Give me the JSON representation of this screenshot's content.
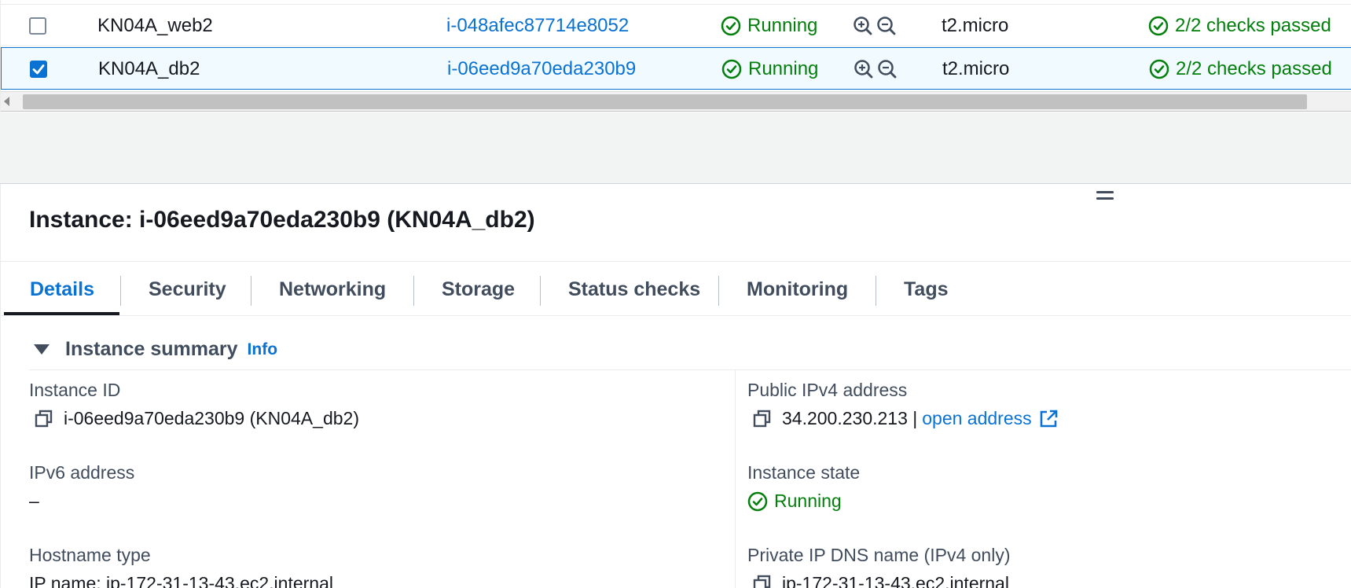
{
  "table": {
    "rows": [
      {
        "selected": false,
        "name": "KN04A_web2",
        "instance_id": "i-048afec87714e8052",
        "state": "Running",
        "instance_type": "t2.micro",
        "status_check": "2/2 checks passed"
      },
      {
        "selected": true,
        "name": "KN04A_db2",
        "instance_id": "i-06eed9a70eda230b9",
        "state": "Running",
        "instance_type": "t2.micro",
        "status_check": "2/2 checks passed"
      }
    ]
  },
  "details": {
    "title": "Instance: i-06eed9a70eda230b9 (KN04A_db2)",
    "tabs": [
      {
        "label": "Details",
        "active": true
      },
      {
        "label": "Security",
        "active": false
      },
      {
        "label": "Networking",
        "active": false
      },
      {
        "label": "Storage",
        "active": false
      },
      {
        "label": "Status checks",
        "active": false
      },
      {
        "label": "Monitoring",
        "active": false
      },
      {
        "label": "Tags",
        "active": false
      }
    ],
    "summary": {
      "title": "Instance summary",
      "info_label": "Info",
      "instance_id_label": "Instance ID",
      "instance_id_value": "i-06eed9a70eda230b9 (KN04A_db2)",
      "public_ipv4_label": "Public IPv4 address",
      "public_ipv4_value": "34.200.230.213 |",
      "open_address_label": "open address",
      "ipv6_label": "IPv6 address",
      "ipv6_value": "–",
      "instance_state_label": "Instance state",
      "instance_state_value": "Running",
      "hostname_type_label": "Hostname type",
      "hostname_type_value": "IP name: ip-172-31-13-43.ec2.internal",
      "private_dns_label": "Private IP DNS name (IPv4 only)",
      "private_dns_value": "ip-172-31-13-43.ec2.internal"
    }
  },
  "colors": {
    "link": "#0972d3",
    "success": "#037f0c",
    "selected_row_bg": "#f1faff"
  }
}
